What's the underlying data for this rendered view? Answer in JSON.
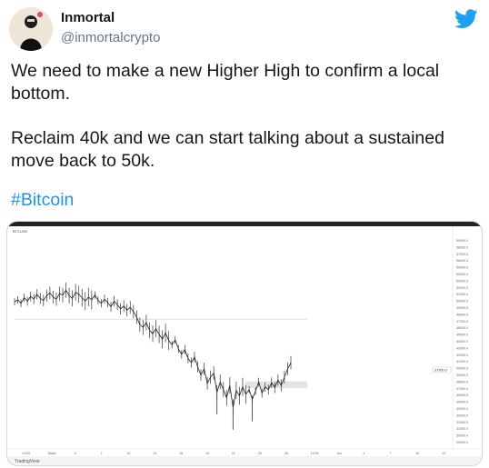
{
  "author": {
    "display_name": "Inmortal",
    "handle": "@inmortalcrypto"
  },
  "tweet": {
    "lines": [
      "We need to make a new Higher High to confirm a local",
      "bottom.",
      "Reclaim 40k and we can start talking about a sustained",
      "move back to 50k."
    ],
    "hashtag": "#Bitcoin"
  },
  "icons": {
    "brand": "twitter-bird-icon",
    "brand_color": "#1da1f2",
    "link_color": "#1b95e0"
  },
  "chart_data": {
    "type": "line",
    "source": "TradingView",
    "symbol_header": "BTCUSD",
    "price_label_right": "37500.0",
    "x_tick_labels": [
      "14:00",
      "Mayo",
      "4",
      "7",
      "10",
      "13",
      "16",
      "19",
      "22",
      "25",
      "28",
      "14:00",
      "Jun",
      "4",
      "7",
      "10",
      "13"
    ],
    "y_tick_labels": [
      "59000.0",
      "58000.0",
      "57000.0",
      "56000.0",
      "55000.0",
      "54000.0",
      "53000.0",
      "52000.0",
      "51000.0",
      "50000.0",
      "49000.0",
      "48000.0",
      "47000.0",
      "46000.0",
      "45000.0",
      "44000.0",
      "43000.0",
      "42000.0",
      "41000.0",
      "40000.0",
      "39000.0",
      "38000.0",
      "37000.0",
      "36000.0",
      "35000.0",
      "34000.0",
      "33000.0",
      "32000.0",
      "31000.0",
      "30000.0",
      "29000.0"
    ],
    "ylim": [
      29000,
      59000
    ],
    "series": [
      {
        "values": [
          49500,
          49800,
          49300,
          50100,
          49600,
          50300,
          49900,
          50600,
          50000,
          49700,
          50400,
          50800,
          50200,
          49900,
          50700,
          50500,
          51200,
          50400,
          50000,
          50900,
          50600,
          50100,
          49600,
          50200,
          49800,
          50500,
          49700,
          49300,
          49900,
          49400,
          48800,
          49600,
          49100,
          48500,
          48900,
          48300,
          48700,
          48100,
          47300,
          46200,
          45800,
          46500,
          45400,
          44900,
          45600,
          44800,
          44100,
          45000,
          43900,
          43300,
          44000,
          42700,
          41900,
          42600,
          41300,
          40700,
          41500,
          40100,
          38900,
          39800,
          37700,
          38600,
          39200,
          36400,
          37900,
          36800,
          35600,
          37400,
          34200,
          36700,
          35900,
          37200,
          36100,
          36800,
          35400,
          36600,
          37900,
          36300,
          37200,
          36800,
          37800,
          37100,
          38200,
          37400,
          38600,
          39800,
          40700
        ]
      }
    ],
    "annotations": [
      {
        "type": "horizontal-line",
        "value": 47000
      },
      {
        "type": "range-zone",
        "from": 37000,
        "to": 38000
      }
    ]
  }
}
